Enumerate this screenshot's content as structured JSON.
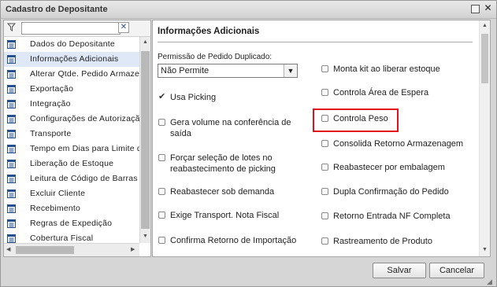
{
  "window": {
    "title": "Cadastro de Depositante",
    "maximize_icon": "maximize-icon",
    "close_icon": "close-icon",
    "close_glyph": "✕"
  },
  "sidebar": {
    "filter_icon": "filter-icon",
    "filter_value": "",
    "clear_icon": "clear-icon",
    "clear_glyph": "✕",
    "selected_index": 1,
    "items": [
      {
        "label": "Dados do Depositante"
      },
      {
        "label": "Informações Adicionais"
      },
      {
        "label": "Alterar Qtde. Pedido Armazenagem"
      },
      {
        "label": "Exportação"
      },
      {
        "label": "Integração"
      },
      {
        "label": "Configurações de Autorização"
      },
      {
        "label": "Transporte"
      },
      {
        "label": "Tempo em Dias para Limite de"
      },
      {
        "label": "Liberação de Estoque"
      },
      {
        "label": "Leitura de Código de Barras"
      },
      {
        "label": "Excluir Cliente"
      },
      {
        "label": "Recebimento"
      },
      {
        "label": "Regras de Expedição"
      },
      {
        "label": "Cobertura Fiscal"
      }
    ]
  },
  "main": {
    "section_title": "Informações Adicionais",
    "duplicate_label": "Permissão de Pedido Duplicado:",
    "duplicate_value": "Não Permite",
    "left_checks": [
      {
        "label": "Usa Picking",
        "checked": true
      },
      {
        "label": "Gera volume na conferência de saída",
        "checked": false
      },
      {
        "label": "Forçar seleção de lotes no reabastecimento de picking",
        "checked": false
      },
      {
        "label": "Reabastecer sob demanda",
        "checked": false
      },
      {
        "label": "Exige Transport. Nota Fiscal",
        "checked": false
      },
      {
        "label": "Confirma Retorno de Importação",
        "checked": false
      }
    ],
    "right_checks": [
      {
        "label": "Monta kit ao liberar estoque",
        "checked": false
      },
      {
        "label": "Controla Área de Espera",
        "checked": false
      },
      {
        "label": "Controla Peso",
        "checked": false,
        "highlighted": true,
        "highlight_color": "#e3111b"
      },
      {
        "label": "Consolida Retorno Armazenagem",
        "checked": false
      },
      {
        "label": "Reabastecer por embalagem",
        "checked": false
      },
      {
        "label": "Dupla Confirmação do Pedido",
        "checked": false
      },
      {
        "label": "Retorno Entrada NF Completa",
        "checked": false
      },
      {
        "label": "Rastreamento de Produto",
        "checked": false
      }
    ]
  },
  "footer": {
    "save_label": "Salvar",
    "cancel_label": "Cancelar"
  },
  "colors": {
    "selected_bg": "#dfe8f6",
    "highlight": "#e3111b",
    "icon_blue": "#27508f"
  }
}
